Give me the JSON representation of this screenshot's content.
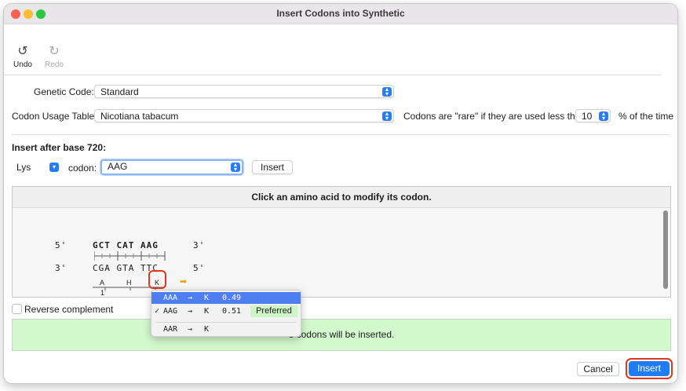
{
  "window": {
    "title": "Insert Codons into Synthetic"
  },
  "toolbar": {
    "undo_label": "Undo",
    "redo_label": "Redo"
  },
  "form": {
    "genetic_code_label": "Genetic Code:",
    "genetic_code_value": "Standard",
    "codon_usage_label": "Codon Usage Table:",
    "codon_usage_value": "Nicotiana tabacum",
    "rare_label": "Codons are \"rare\" if they are used less than",
    "rare_value": "10",
    "rare_suffix": "% of the time",
    "insert_after_label": "Insert after base 720:",
    "amino_acid_value": "Lys",
    "codon_label": "codon:",
    "codon_value": "AAG",
    "insert_inline_label": "Insert"
  },
  "panel": {
    "header": "Click an amino acid to modify its codon.",
    "top_strand": {
      "prime5": "5'",
      "seq": "GCT CAT AAG",
      "prime3": "3'"
    },
    "bottom_strand": {
      "prime3": "3'",
      "seq": "CGA GTA TTC",
      "prime5": "5'"
    },
    "amino_acids": [
      "A",
      "H",
      "K"
    ],
    "ruler_number": "1",
    "arrow_glyph": "➡"
  },
  "menu": {
    "items": [
      {
        "check": "",
        "codon": "AAA",
        "arrow": "→",
        "aa": "K",
        "freq": "0.49",
        "badge": ""
      },
      {
        "check": "✓",
        "codon": "AAG",
        "arrow": "→",
        "aa": "K",
        "freq": "0.51",
        "badge": "Preferred"
      },
      {
        "check": "",
        "codon": "AAR",
        "arrow": "→",
        "aa": "K",
        "freq": "",
        "badge": ""
      }
    ]
  },
  "reverse_complement_label": "Reverse complement",
  "status": "3 codons will be inserted.",
  "footer": {
    "cancel_label": "Cancel",
    "insert_label": "Insert"
  },
  "colors": {
    "accent": "#1f7cf4",
    "highlight_ring": "#e0351f",
    "status_bg": "#d3f8cd",
    "menu_highlight": "#4f7ef1"
  }
}
